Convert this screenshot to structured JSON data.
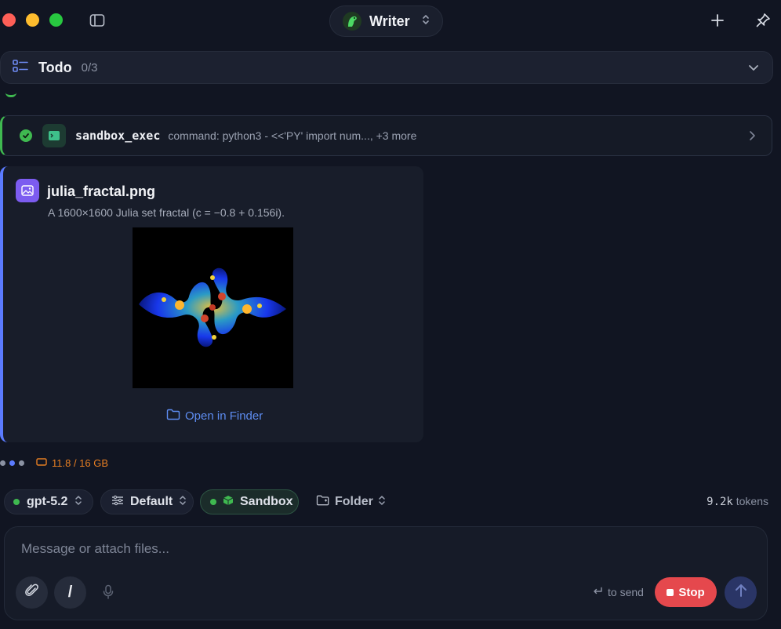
{
  "window": {
    "agent_name": "Writer",
    "icons": [
      "close",
      "minimize",
      "maximize",
      "sidebar-toggle-icon",
      "parrot-icon",
      "chevron-updown-icon",
      "plus-icon",
      "pin-icon"
    ]
  },
  "todo": {
    "title": "Todo",
    "count": "0/3"
  },
  "tool_call": {
    "name": "sandbox_exec",
    "args": "command: python3 - <<'PY' import num..., +3 more",
    "status": "success"
  },
  "image_card": {
    "filename": "julia_fractal.png",
    "description": "A 1600×1600 Julia set fractal (c = −0.8 + 0.156i).",
    "open_label": "Open in Finder"
  },
  "status": {
    "memory": "11.8 / 16 GB"
  },
  "chips": {
    "model": "gpt-5.2",
    "mode": "Default",
    "sandbox": "Sandbox",
    "folder": "Folder"
  },
  "tokens": {
    "value": "9.2k",
    "unit": "tokens"
  },
  "composer": {
    "placeholder": "Message or attach files...",
    "slash_label": "/",
    "send_hint": "to send",
    "stop_label": "Stop"
  },
  "colors": {
    "background": "#111522",
    "success": "#3fb950",
    "accent_blue": "#5b7bff",
    "stop_red": "#e5484d",
    "memory_orange": "#e67e22"
  }
}
